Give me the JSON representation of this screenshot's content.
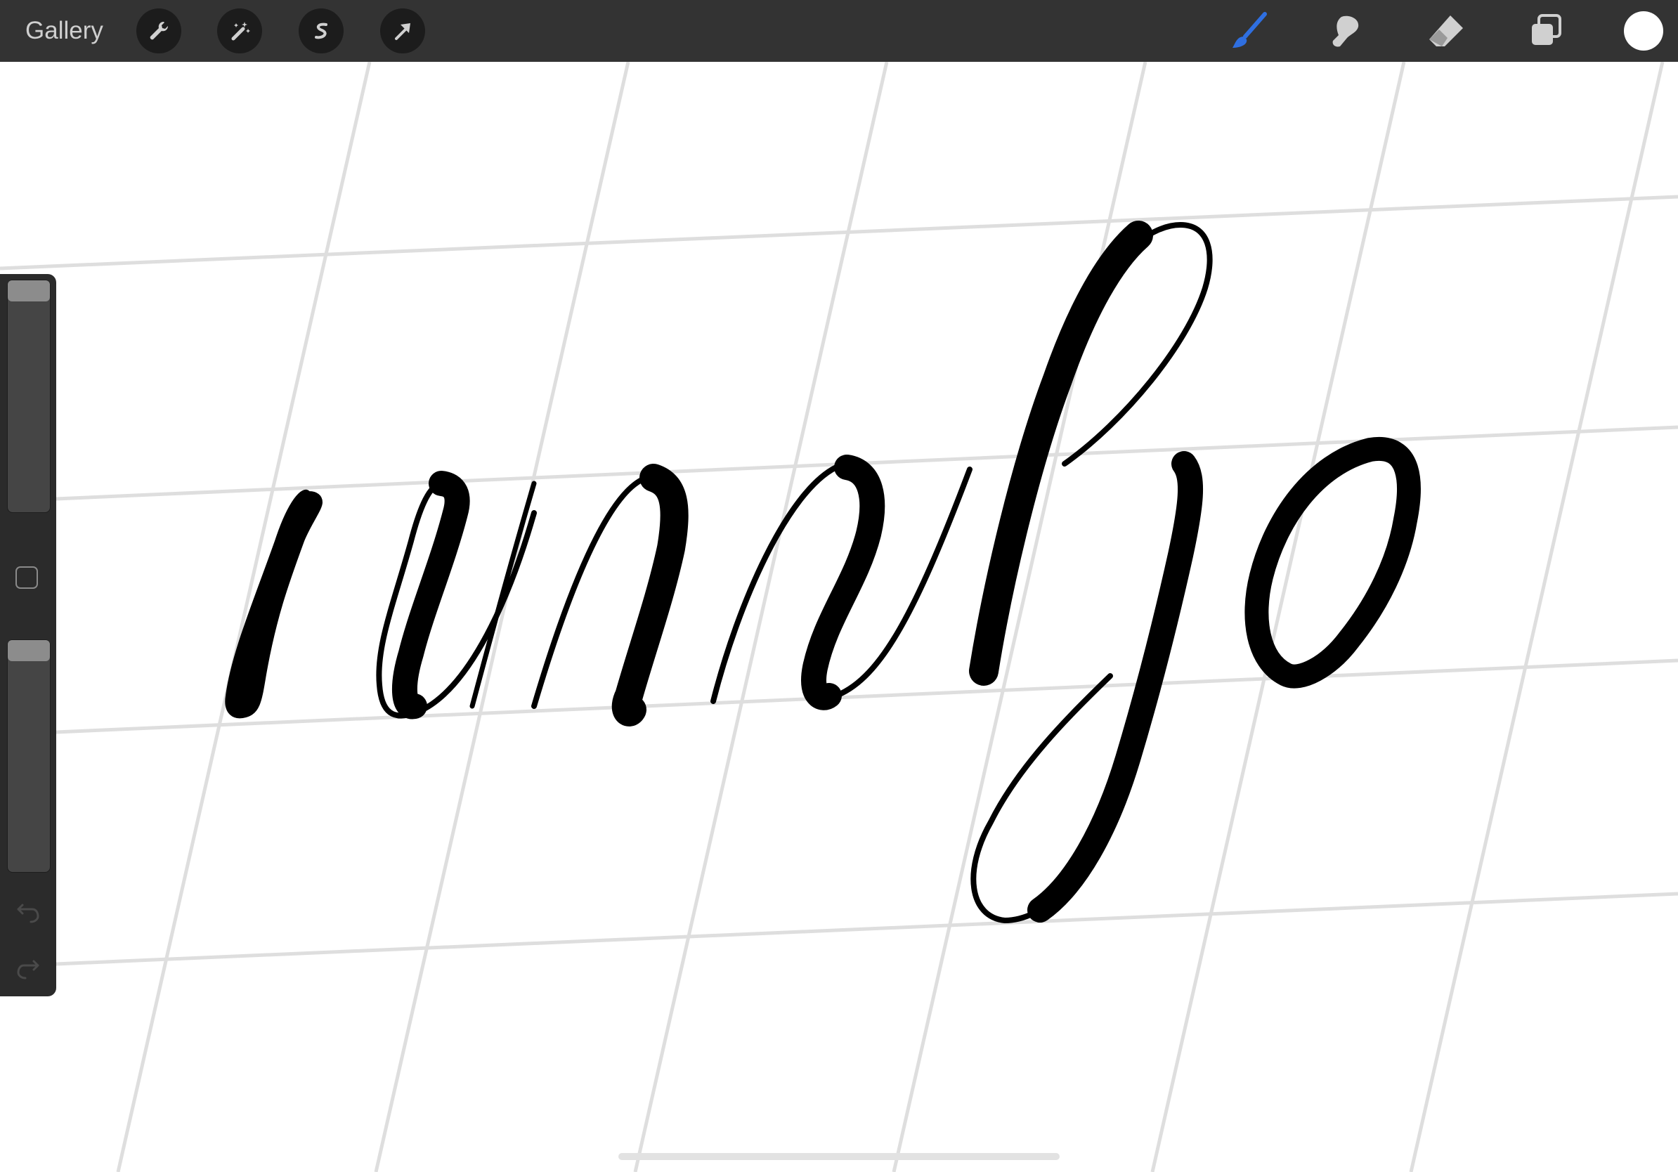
{
  "toolbar": {
    "gallery_label": "Gallery",
    "left_tools": [
      "wrench-icon",
      "magic-wand-icon",
      "selection-icon",
      "transform-arrow-icon"
    ],
    "right_tools": [
      "brush-icon",
      "smudge-icon",
      "eraser-icon",
      "layers-icon"
    ],
    "active_tool": "brush-icon",
    "active_color": "#ffffff",
    "accent_color": "#2f6fe0"
  },
  "sidebar": {
    "brush_size": 0.0,
    "brush_opacity": 0.0,
    "controls": [
      "brush-size-slider",
      "modify-button",
      "brush-opacity-slider",
      "undo-icon",
      "redo-icon"
    ]
  },
  "canvas": {
    "background": "#ffffff",
    "guide_color": "#dcdcdc",
    "ink_color": "#000000"
  }
}
